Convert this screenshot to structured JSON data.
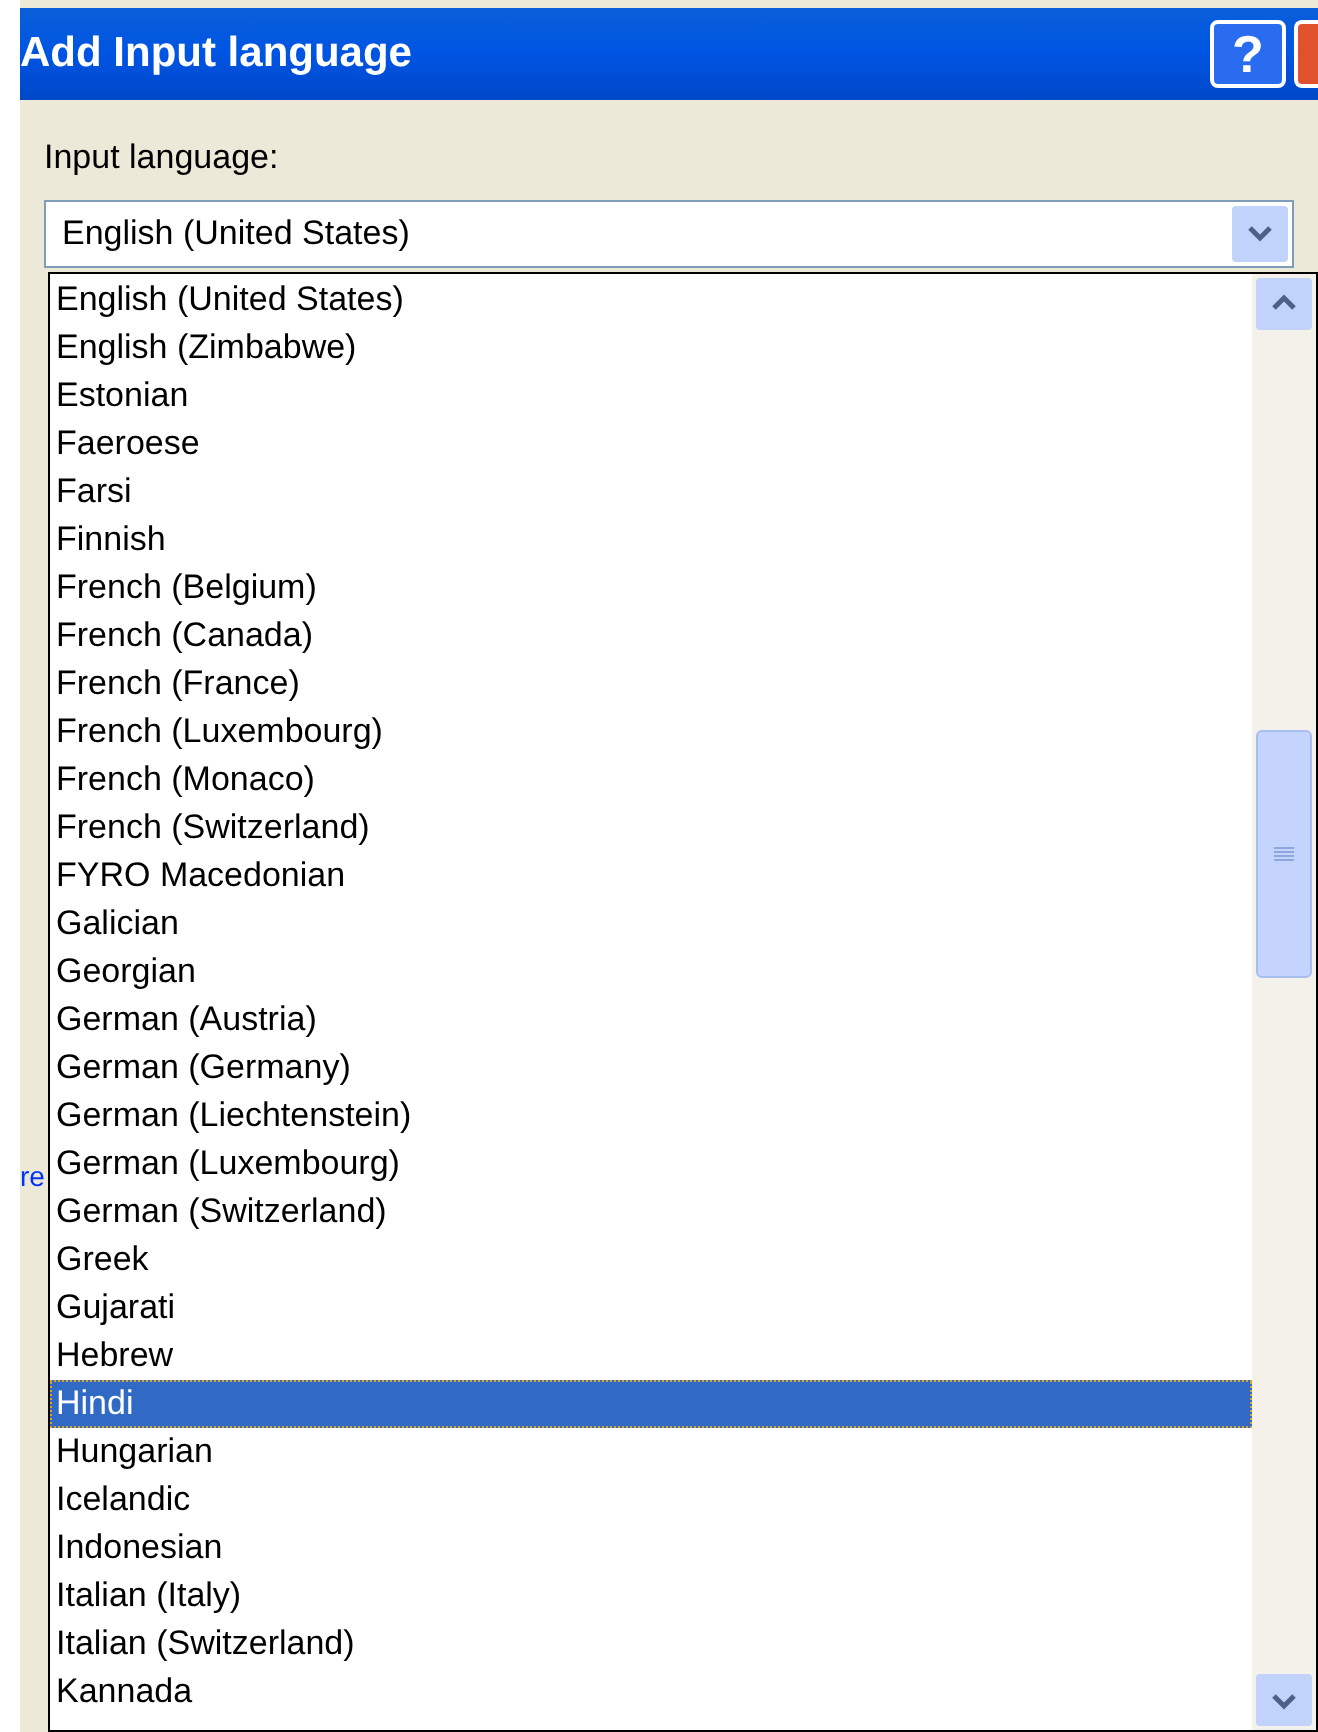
{
  "window": {
    "title": "Add Input language",
    "help_button": "?"
  },
  "field_label": "Input language:",
  "combo": {
    "value": "English (United States)"
  },
  "background_fragment": "re",
  "list": [
    {
      "label": "English (United States)",
      "selected": false
    },
    {
      "label": "English (Zimbabwe)",
      "selected": false
    },
    {
      "label": "Estonian",
      "selected": false
    },
    {
      "label": "Faeroese",
      "selected": false
    },
    {
      "label": "Farsi",
      "selected": false
    },
    {
      "label": "Finnish",
      "selected": false
    },
    {
      "label": "French (Belgium)",
      "selected": false
    },
    {
      "label": "French (Canada)",
      "selected": false
    },
    {
      "label": "French (France)",
      "selected": false
    },
    {
      "label": "French (Luxembourg)",
      "selected": false
    },
    {
      "label": "French (Monaco)",
      "selected": false
    },
    {
      "label": "French (Switzerland)",
      "selected": false
    },
    {
      "label": "FYRO Macedonian",
      "selected": false
    },
    {
      "label": "Galician",
      "selected": false
    },
    {
      "label": "Georgian",
      "selected": false
    },
    {
      "label": "German (Austria)",
      "selected": false
    },
    {
      "label": "German (Germany)",
      "selected": false
    },
    {
      "label": "German (Liechtenstein)",
      "selected": false
    },
    {
      "label": "German (Luxembourg)",
      "selected": false
    },
    {
      "label": "German (Switzerland)",
      "selected": false
    },
    {
      "label": "Greek",
      "selected": false
    },
    {
      "label": "Gujarati",
      "selected": false
    },
    {
      "label": "Hebrew",
      "selected": false
    },
    {
      "label": "Hindi",
      "selected": true
    },
    {
      "label": "Hungarian",
      "selected": false
    },
    {
      "label": "Icelandic",
      "selected": false
    },
    {
      "label": "Indonesian",
      "selected": false
    },
    {
      "label": "Italian (Italy)",
      "selected": false
    },
    {
      "label": "Italian (Switzerland)",
      "selected": false
    },
    {
      "label": "Kannada",
      "selected": false
    }
  ]
}
